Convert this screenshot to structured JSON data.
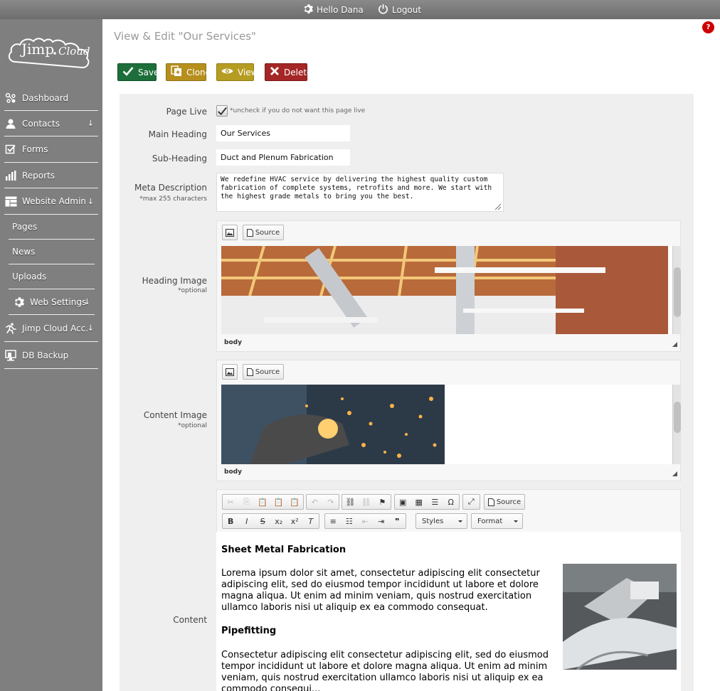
{
  "topbar": {
    "hello": "Hello Dana",
    "logout": "Logout"
  },
  "logo": {
    "part1": "Jimp",
    "part2": "Cloud"
  },
  "sidebar": {
    "items": [
      {
        "label": "Dashboard",
        "icon": "dashboard-icon"
      },
      {
        "label": "Contacts",
        "icon": "user-icon",
        "arrow": "↓"
      },
      {
        "label": "Forms",
        "icon": "checkbox-icon"
      },
      {
        "label": "Reports",
        "icon": "bar-chart-icon"
      },
      {
        "label": "Website Admin",
        "icon": "layout-icon",
        "arrow": "↓"
      },
      {
        "label": "Pages"
      },
      {
        "label": "News"
      },
      {
        "label": "Uploads"
      },
      {
        "label": "Web Settings",
        "icon": "gear-icon",
        "arrow": "↓"
      },
      {
        "label": "Jimp Cloud Acc.",
        "icon": "runner-icon",
        "arrow": "↓"
      },
      {
        "label": "DB Backup",
        "icon": "backup-icon"
      }
    ]
  },
  "page": {
    "title": "View & Edit \"Our Services\"",
    "help": "?"
  },
  "actions": {
    "save": "Save",
    "clone": "Clone",
    "view": "View",
    "delete": "Delete"
  },
  "form": {
    "page_live_label": "Page Live",
    "page_live_checked": true,
    "page_live_note": "*uncheck if you do not want this page live",
    "main_heading_label": "Main Heading",
    "main_heading_value": "Our Services",
    "sub_heading_label": "Sub-Heading",
    "sub_heading_value": "Duct and Plenum Fabrication",
    "meta_label": "Meta Description",
    "meta_note": "*max 255 characters",
    "meta_value": "We redefine HVAC service by delivering the highest quality custom fabrication of complete systems, retrofits and more. We start with the highest grade metals to bring you the best.",
    "heading_image_label": "Heading Image",
    "heading_image_note": "*optional",
    "content_image_label": "Content Image",
    "content_image_note": "*optional",
    "content_label": "Content"
  },
  "editor": {
    "source": "Source",
    "path": "body",
    "styles": "Styles",
    "format": "Format"
  },
  "content": {
    "h1": "Sheet Metal Fabrication",
    "p1": "Lorema ipsum dolor sit amet, consectetur adipiscing elit consectetur adipiscing elit, sed do eiusmod tempor incididunt ut labore et dolore magna aliqua. Ut enim ad minim veniam, quis nostrud exercitation ullamco laboris nisi ut aliquip ex ea commodo consequat.",
    "h2": "Pipefitting",
    "p2": "Consectetur adipiscing elit consectetur adipiscing elit, sed do eiusmod tempor incididunt ut labore et dolore magna aliqua. Ut enim ad minim veniam, quis nostrud exercitation ullamco laboris nisi ut aliquip ex ea commodo consequi..."
  },
  "colors": {
    "save": "#1d6e3a",
    "clone": "#b68f1d",
    "view": "#b59c22",
    "delete": "#a52626",
    "sidebar": "#7f7f7f",
    "topbar": "#777777"
  }
}
